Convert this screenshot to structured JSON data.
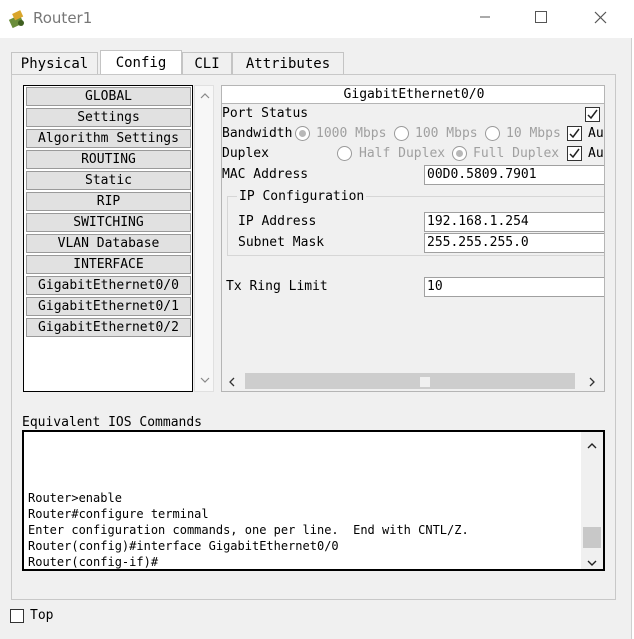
{
  "window": {
    "title": "Router1",
    "minimize_icon": "minimize-icon",
    "maximize_icon": "maximize-icon",
    "close_icon": "close-icon"
  },
  "tabs": [
    {
      "label": "Physical",
      "active": false
    },
    {
      "label": "Config",
      "active": true
    },
    {
      "label": "CLI",
      "active": false
    },
    {
      "label": "Attributes",
      "active": false
    }
  ],
  "left_list": {
    "items": [
      "GLOBAL",
      "Settings",
      "Algorithm Settings",
      "ROUTING",
      "Static",
      "RIP",
      "SWITCHING",
      "VLAN Database",
      "INTERFACE",
      "GigabitEthernet0/0",
      "GigabitEthernet0/1",
      "GigabitEthernet0/2"
    ]
  },
  "interface": {
    "header": "GigabitEthernet0/0",
    "port_status_label": "Port Status",
    "port_status_on": true,
    "bandwidth_label": "Bandwidth",
    "bandwidth_options": [
      "1000 Mbps",
      "100 Mbps",
      "10 Mbps"
    ],
    "auto_label": "Au",
    "bandwidth_auto": true,
    "duplex_label": "Duplex",
    "duplex_options": [
      "Half Duplex",
      "Full Duplex"
    ],
    "duplex_auto": true,
    "mac_label": "MAC Address",
    "mac_value": "00D0.5809.7901",
    "ip_config_title": "IP Configuration",
    "ip_label": "IP Address",
    "ip_value": "192.168.1.254",
    "mask_label": "Subnet Mask",
    "mask_value": "255.255.255.0",
    "tx_label": "Tx Ring Limit",
    "tx_value": "10"
  },
  "ios": {
    "label": "Equivalent IOS Commands",
    "lines": [
      "Router>enable",
      "Router#configure terminal",
      "Enter configuration commands, one per line.  End with CNTL/Z.",
      "Router(config)#interface GigabitEthernet0/0",
      "Router(config-if)#"
    ]
  },
  "bottom": {
    "top_label": "Top",
    "top_checked": false
  },
  "colors": {
    "window_bg": "#f0f0f0",
    "list_item_bg": "#e1e1e1",
    "disabled_text": "#a0a0a0"
  }
}
